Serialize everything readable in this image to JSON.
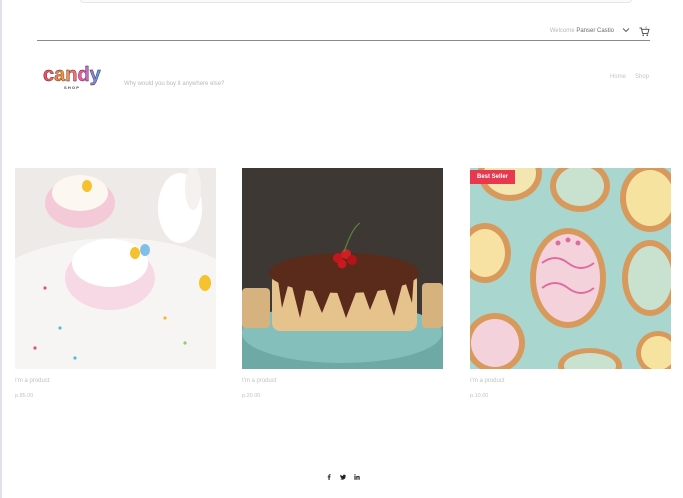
{
  "header": {
    "welcome_prefix": "Welcome",
    "user_name": "Panser Castio",
    "cart_count": "0"
  },
  "brand": {
    "logo_word": "candy",
    "logo_sub": "SHOP",
    "tagline": "Why would you buy it anywhere else?"
  },
  "nav": {
    "items": [
      {
        "label": "Home"
      },
      {
        "label": "Shop"
      }
    ]
  },
  "products": [
    {
      "name": "I'm a product",
      "price": "p.85.00",
      "badge": ""
    },
    {
      "name": "I'm a product",
      "price": "p.20.00",
      "badge": ""
    },
    {
      "name": "I'm a product",
      "price": "p.10.00",
      "badge": "Best Seller"
    }
  ],
  "social": [
    "facebook-icon",
    "twitter-icon",
    "linkedin-icon"
  ],
  "colors": {
    "badge": "#e8384f",
    "muted_text": "#c2c2c2",
    "rule": "#8a8a8a"
  }
}
